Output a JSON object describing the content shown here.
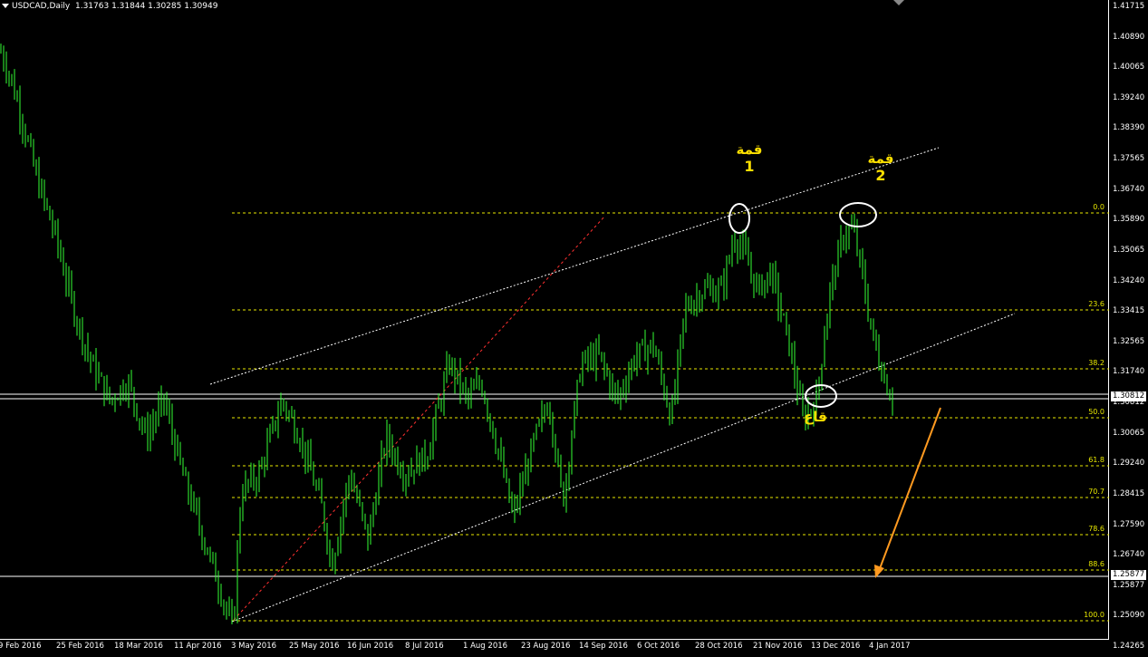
{
  "header": {
    "symbol": "USDCAD,Daily",
    "ohlc": "1.31763 1.31844 1.30285 1.30949"
  },
  "price_axis": [
    "1.41715",
    "1.40890",
    "1.40065",
    "1.39240",
    "1.38390",
    "1.37565",
    "1.36740",
    "1.35890",
    "1.35065",
    "1.34240",
    "1.33415",
    "1.32565",
    "1.31740",
    "1.30812",
    "1.30065",
    "1.29240",
    "1.28415",
    "1.27590",
    "1.26740",
    "1.25877",
    "1.25090",
    "1.24265"
  ],
  "time_axis": [
    "9 Feb 2016",
    "25 Feb 2016",
    "18 Mar 2016",
    "11 Apr 2016",
    "3 May 2016",
    "25 May 2016",
    "16 Jun 2016",
    "8 Jul 2016",
    "1 Aug 2016",
    "23 Aug 2016",
    "14 Sep 2016",
    "6 Oct 2016",
    "28 Oct 2016",
    "21 Nov 2016",
    "13 Dec 2016",
    "4 Jan 2017"
  ],
  "fib_levels": [
    "0.0",
    "23.6",
    "38.2",
    "50.0",
    "61.8",
    "70.7",
    "78.6",
    "88.6",
    "100.0"
  ],
  "current_price": "1.30812",
  "support_price": "1.25877",
  "annotations": {
    "top1_word": "قمة",
    "top1_num": "1",
    "top2_word": "قمة",
    "top2_num": "2",
    "bottom_word": "قاع"
  },
  "colors": {
    "candles": "#33ff33",
    "fib": "#e8e800",
    "trend": "#ffffff",
    "red_line": "#ff3030",
    "arrow": "#ff9a20",
    "annotation": "#ffe000"
  },
  "chart_data": {
    "type": "candlestick",
    "title": "USDCAD,Daily",
    "ylim": [
      1.24265,
      1.41715
    ],
    "values_close_approx": [
      1.405,
      1.38,
      1.36,
      1.33,
      1.315,
      1.29,
      1.27,
      1.255,
      1.29,
      1.3,
      1.31,
      1.29,
      1.3,
      1.27,
      1.3,
      1.31,
      1.315,
      1.29,
      1.28,
      1.31,
      1.32,
      1.31,
      1.32,
      1.34,
      1.355,
      1.34,
      1.33,
      1.31,
      1.33,
      1.355,
      1.34,
      1.32,
      1.309
    ]
  }
}
